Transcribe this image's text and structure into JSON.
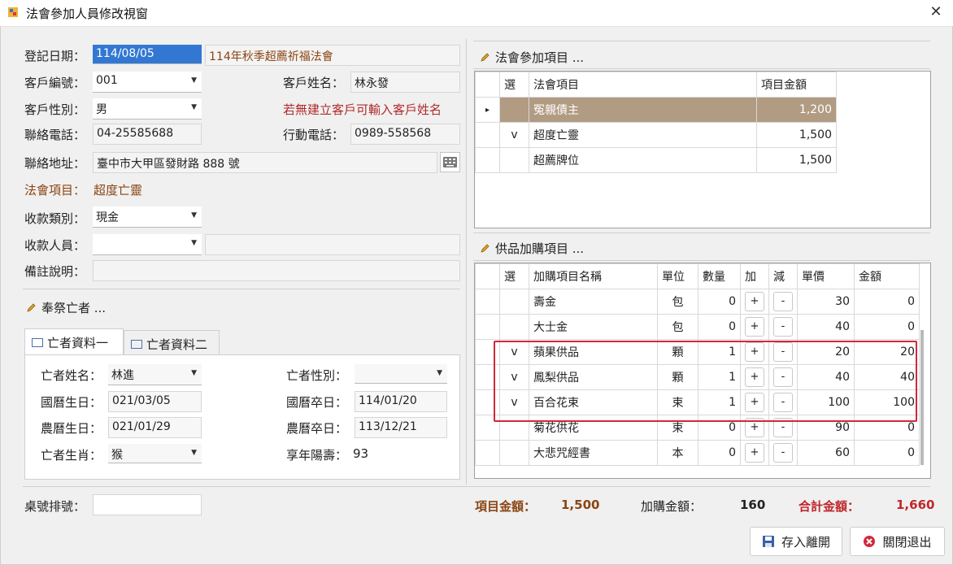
{
  "window": {
    "title": "法會參加人員修改視窗",
    "close_glyph": "✕"
  },
  "form": {
    "reg_date_label": "登記日期：",
    "reg_date_value": "114/08/05",
    "event_name": "114年秋季超薦祈福法會",
    "cust_no_label": "客戶編號：",
    "cust_no_value": "001",
    "cust_name_label": "客戶姓名：",
    "cust_name_value": "林永發",
    "gender_label": "客戶性別：",
    "gender_value": "男",
    "hint": "若無建立客戶可輸入客戶姓名",
    "phone_label": "聯絡電話：",
    "phone_value": "04-25585688",
    "mobile_label": "行動電話：",
    "mobile_value": "0989-558568",
    "address_label": "聯絡地址：",
    "address_value": "臺中市大甲區發財路 888 號",
    "item_label": "法會項目：",
    "item_value": "超度亡靈",
    "pay_type_label": "收款類別：",
    "pay_type_value": "現金",
    "payee_label": "收款人員：",
    "payee_value": "",
    "note_label": "備註說明：",
    "note_value": ""
  },
  "deceased": {
    "section_title": "奉祭亡者 ...",
    "tabs": [
      {
        "label": "亡者資料一"
      },
      {
        "label": "亡者資料二"
      }
    ],
    "name_label": "亡者姓名：",
    "name_value": "林進",
    "gender_label": "亡者性別：",
    "gender_value": "",
    "birth_label": "國曆生日：",
    "birth_value": "021/03/05",
    "death_label": "國曆卒日：",
    "death_value": "114/01/20",
    "lunar_birth_label": "農曆生日：",
    "lunar_birth_value": "021/01/29",
    "lunar_death_label": "農曆卒日：",
    "lunar_death_value": "113/12/21",
    "zodiac_label": "亡者生肖：",
    "zodiac_value": "猴",
    "age_label": "享年陽壽：",
    "age_value": "93"
  },
  "ceremony": {
    "section_title": "法會參加項目 ...",
    "headers": {
      "sel": "選",
      "item": "法會項目",
      "amount": "項目金額"
    },
    "rows": [
      {
        "marker": "▸",
        "sel": "",
        "item": "冤親債主",
        "amount": "1,200"
      },
      {
        "marker": "",
        "sel": "v",
        "item": "超度亡靈",
        "amount": "1,500"
      },
      {
        "marker": "",
        "sel": "",
        "item": "超薦牌位",
        "amount": "1,500"
      }
    ]
  },
  "offerings": {
    "section_title": "供品加購項目 ...",
    "headers": {
      "sel": "選",
      "name": "加購項目名稱",
      "unit": "單位",
      "qty": "數量",
      "add": "加",
      "sub": "減",
      "price": "單價",
      "amount": "金額"
    },
    "plus": "+",
    "minus": "-",
    "rows": [
      {
        "sel": "",
        "name": "壽金",
        "unit": "包",
        "qty": "0",
        "price": "30",
        "amount": "0"
      },
      {
        "sel": "",
        "name": "大士金",
        "unit": "包",
        "qty": "0",
        "price": "40",
        "amount": "0"
      },
      {
        "sel": "v",
        "name": "蘋果供品",
        "unit": "顆",
        "qty": "1",
        "price": "20",
        "amount": "20"
      },
      {
        "sel": "v",
        "name": "鳳梨供品",
        "unit": "顆",
        "qty": "1",
        "price": "40",
        "amount": "40"
      },
      {
        "sel": "v",
        "name": "百合花束",
        "unit": "束",
        "qty": "1",
        "price": "100",
        "amount": "100"
      },
      {
        "sel": "",
        "name": "菊花供花",
        "unit": "束",
        "qty": "0",
        "price": "90",
        "amount": "0"
      },
      {
        "sel": "",
        "name": "大悲咒經書",
        "unit": "本",
        "qty": "0",
        "price": "60",
        "amount": "0"
      }
    ]
  },
  "footer": {
    "table_label": "桌號排號：",
    "table_value": "",
    "item_total_label": "項目金額：",
    "item_total_value": "1,500",
    "extra_total_label": "加購金額：",
    "extra_total_value": "160",
    "grand_total_label": "合計金額：",
    "grand_total_value": "1,660",
    "save_label": "存入離開",
    "close_label": "關閉退出"
  },
  "colors": {
    "selected_row": "#b19b82",
    "highlight_box": "#d0283a",
    "accent_brown": "#8b4513",
    "hint_red": "#b02a2a"
  }
}
